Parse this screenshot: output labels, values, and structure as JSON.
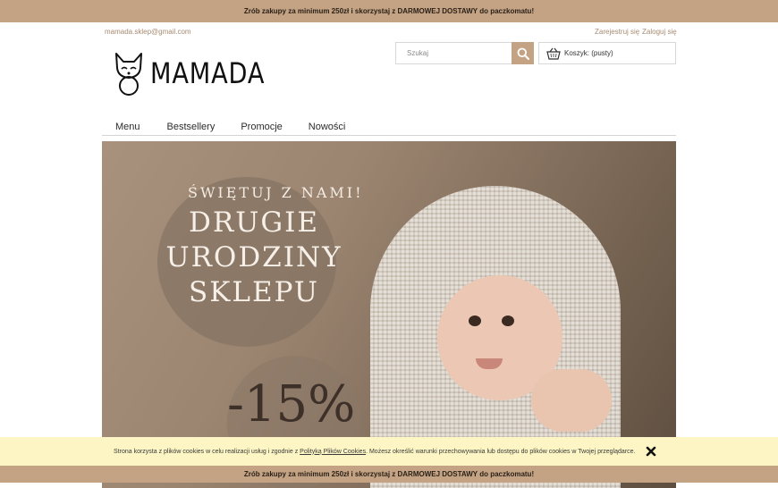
{
  "promo_bar": {
    "text": "Zrób zakupy za minimum 250zł i skorzystaj z DARMOWEJ DOSTAWY do paczkomatu!"
  },
  "header": {
    "email": "mamada.sklep@gmail.com",
    "register_label": "Zarejestruj się",
    "login_label": "Zaloguj się",
    "logo_text": "MAMADA",
    "search_placeholder": "Szukaj",
    "cart_label": "Koszyk: (pusty)"
  },
  "nav": {
    "items": [
      "Menu",
      "Bestsellery",
      "Promocje",
      "Nowości"
    ]
  },
  "hero": {
    "line1": "ŚWIĘTUJ Z NAMI!",
    "line2": "DRUGIE",
    "line3": "URODZINY",
    "line4": "SKLEPU",
    "discount": "-15%"
  },
  "cookie_notice": {
    "text_before": "Strona korzysta z plików cookies w celu realizacji usług i zgodnie z ",
    "link_text": "Polityką Plików Cookies",
    "text_after": ". Możesz określić warunki przechowywania lub dostępu do plików cookies w Twojej przeglądarce."
  },
  "colors": {
    "accent": "#c4a384",
    "cookie_bg": "#fdf6c4"
  }
}
